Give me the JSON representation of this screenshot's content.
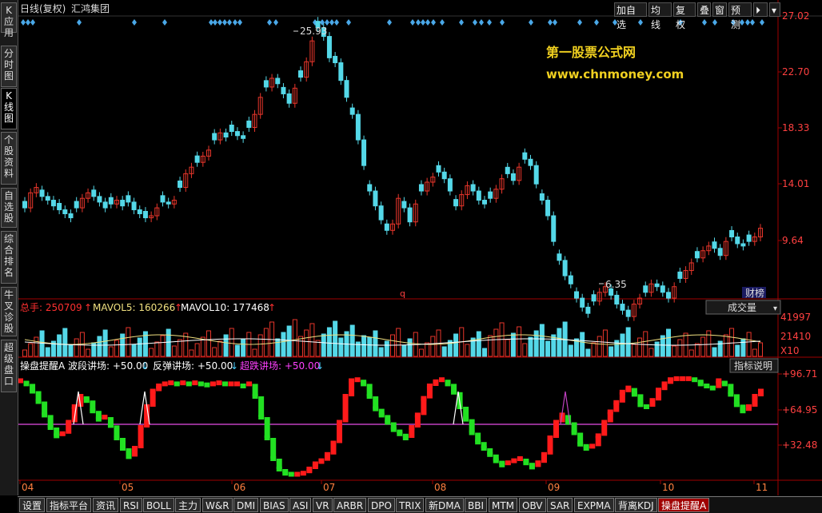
{
  "sidebar": {
    "tabs": [
      {
        "label": "K 应用",
        "active": false
      },
      {
        "label": "分时图",
        "active": false
      },
      {
        "label": "K 线图",
        "active": true
      },
      {
        "label": "个股资料",
        "active": false
      },
      {
        "label": "自选股",
        "active": false
      },
      {
        "label": "综合排名",
        "active": false
      },
      {
        "label": "牛叉诊股",
        "active": false
      },
      {
        "label": "超级盘口",
        "active": false
      }
    ]
  },
  "header": {
    "chart_title": "日线(复权)",
    "stock_name": "汇鸿集团"
  },
  "toolbar": {
    "buttons": [
      "加自选",
      "均线",
      "复权",
      "叠",
      "窗",
      "预测",
      "⏵",
      "▾"
    ]
  },
  "watermark": {
    "line1": "第一股票公式网",
    "line2": "www.chnmoney.com"
  },
  "price_axis": {
    "labels": [
      "27.02",
      "22.70",
      "18.33",
      "14.01",
      "9.64"
    ]
  },
  "annotations": {
    "high": "25.93",
    "low": "6.35",
    "mark_q": "q",
    "caibang": "财榜"
  },
  "volume": {
    "legend": [
      {
        "text": "总手: 250709",
        "color": "#ff3030"
      },
      {
        "text": "MAVOL5: 160266",
        "color": "#f0e080"
      },
      {
        "text": "MAVOL10: 177468",
        "color": "#ffffff"
      }
    ],
    "selector": "成交量",
    "axis_labels": [
      "41997",
      "21410",
      "X10"
    ]
  },
  "indicator": {
    "legend": [
      {
        "text": "操盘提醒A 波段讲场: +50.00",
        "color": "#ffffff"
      },
      {
        "text": "反弹讲场: +50.00",
        "color": "#ffffff"
      },
      {
        "text": "超跌讲场: +50.00",
        "color": "#ff40ff"
      }
    ],
    "help_button": "指标说明",
    "axis_labels": [
      "+96.71",
      "+64.95",
      "+32.48"
    ]
  },
  "date_axis": {
    "labels": [
      "04",
      "05",
      "06",
      "07",
      "08",
      "09",
      "10",
      "11"
    ]
  },
  "bottom_tabs": [
    "设置",
    "指标平台",
    "资讯",
    "RSI",
    "BOLL",
    "主力",
    "W&R",
    "DMI",
    "BIAS",
    "ASI",
    "VR",
    "ARBR",
    "DPO",
    "TRIX",
    "新DMA",
    "BBI",
    "MTM",
    "OBV",
    "SAR",
    "EXPMA",
    "背离KDJ",
    "操盘提醒A"
  ],
  "active_bottom_tab": "操盘提醒A",
  "colors": {
    "up": "#e8362b",
    "down": "#54d8e8",
    "indicator_up": "#ff1a1a",
    "indicator_down": "#22e022",
    "baseline": "#c040c0",
    "diamond": "#4aa8e8",
    "axis": "#a00000"
  }
}
